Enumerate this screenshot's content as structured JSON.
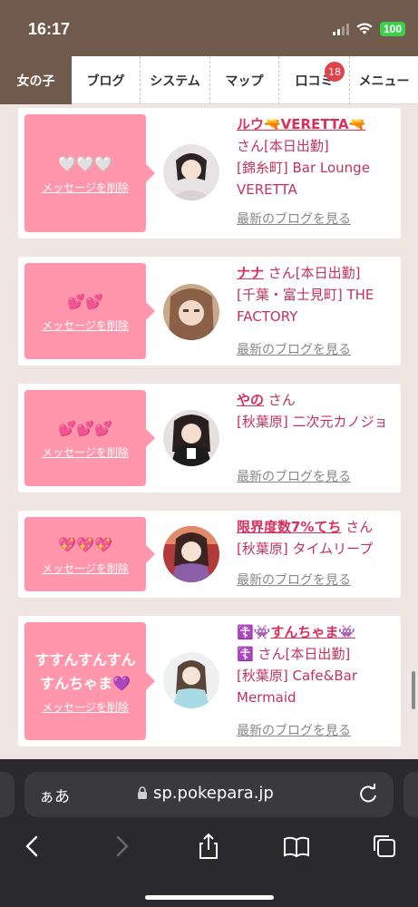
{
  "status": {
    "time": "16:17",
    "battery": "100"
  },
  "tabs": [
    {
      "label": "女の子",
      "active": true
    },
    {
      "label": "ブログ"
    },
    {
      "label": "システム"
    },
    {
      "label": "マップ"
    },
    {
      "label": "口コミ",
      "badge": "18"
    },
    {
      "label": "メニュー"
    }
  ],
  "cards": [
    {
      "message": "🤍🤍🤍",
      "delete_label": "メッセージを削除",
      "name": "ルウ🔫VERETTA🔫",
      "line1_suffix": "さん[本日出勤]",
      "area_shop": "[錦糸町] Bar Lounge VERETTA",
      "blog_label": "最新のブログを見る"
    },
    {
      "message": "💕💕",
      "delete_label": "メッセージを削除",
      "name": "ナナ",
      "line1_suffix": "さん[本日出勤]",
      "area_shop": "[千葉・富士見町] THE FACTORY",
      "blog_label": "最新のブログを見る"
    },
    {
      "message": "💕💕💕",
      "delete_label": "メッセージを削除",
      "name": "やの",
      "line1_suffix": "さん",
      "area_shop": "[秋葉原] 二次元カノジョ",
      "blog_label": "最新のブログを見る"
    },
    {
      "message": "💖💖💖",
      "delete_label": "メッセージを削除",
      "name": "限界度数7%てち",
      "line1_suffix": "さん",
      "area_shop": "[秋葉原] タイムリープ",
      "blog_label": "最新のブログを見る"
    },
    {
      "message": "すすんすんすんすんちゃま💜",
      "delete_label": "メッセージを削除",
      "name_prefix": "☦️👾",
      "name": "すんちゃま👾",
      "name_tag": "☦️",
      "line1_suffix": "さん[本日出勤]",
      "area_shop": "[秋葉原] Cafe&Bar Mermaid",
      "blog_label": "最新のブログを見る"
    }
  ],
  "browser": {
    "aa_label": "ぁあ",
    "url": "sp.pokepara.jp"
  },
  "icons": {
    "back": "chevron-left-icon",
    "forward": "chevron-right-icon",
    "share": "share-icon",
    "bookmarks": "book-icon",
    "tabs": "tabs-icon",
    "lock": "lock-icon",
    "reload": "reload-icon"
  },
  "colors": {
    "brand_brown": "#6f5a4c",
    "bubble_pink": "#ff96ab",
    "name_pink": "#d8305d",
    "badge_red": "#e0444a"
  }
}
